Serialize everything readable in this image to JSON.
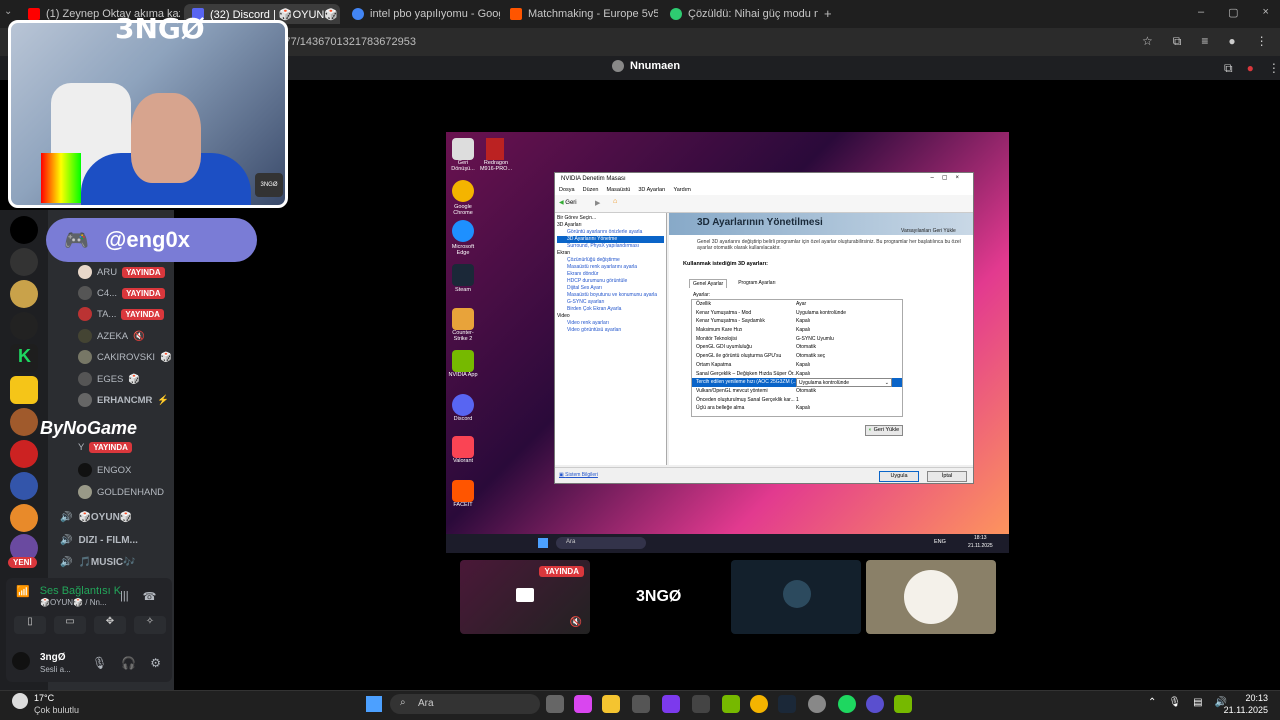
{
  "browser": {
    "tabs": [
      {
        "label": "(1) Zeynep Oktay akıma kaza",
        "icon": "youtube-icon",
        "color": "#ff0000"
      },
      {
        "label": "(32) Discord | 🎲OYUN🎲",
        "icon": "discord-icon",
        "color": "#5865f2"
      },
      {
        "label": "intel pbo yapılıyomu - Google'd",
        "icon": "google-icon",
        "color": "#4285f4"
      },
      {
        "label": "Matchmaking - Europe 5v5 Qu",
        "icon": "faceit-icon",
        "color": "#ff5500"
      },
      {
        "label": "Çözüldü: Nihai güç modu nasıl",
        "icon": "check-icon",
        "color": "#2ecc71"
      }
    ],
    "url": "489477/1436701321783672953"
  },
  "discord": {
    "stream_title": "Nnumaen",
    "name_tag": "@eng0x",
    "watermark": "ByNoGame",
    "members": [
      {
        "name": "ARU",
        "badge": "YAYINDA"
      },
      {
        "name": "C4...",
        "badge": "YAYINDA"
      },
      {
        "name": "TA...",
        "badge": "YAYINDA"
      },
      {
        "name": "AZEKA",
        "badge": ""
      },
      {
        "name": "CAKIROVSKI",
        "badge": ""
      },
      {
        "name": "EGES",
        "badge": ""
      },
      {
        "name": "ERHANCMR",
        "badge": ""
      },
      {
        "name": "Y",
        "badge": "YAYINDA"
      },
      {
        "name": "ENGOX",
        "badge": ""
      },
      {
        "name": "GOLDENHAND",
        "badge": ""
      }
    ],
    "voice_channels": [
      "🎲OYUN🎲",
      "DIZI - FILM...",
      "🎵MUSIC🎶"
    ],
    "new_label": "YENİ",
    "voice_status": "Ses Bağlantısı K",
    "voice_channel_sub": "🎲OYUN🎲 / Nn...",
    "user": {
      "name": "3ngØ",
      "status": "Sesli a..."
    },
    "thumb_badge": "YAYINDA",
    "thumb_logo": "3NGØ",
    "cam_logo": "3NGØ"
  },
  "desktop": {
    "icons": [
      "Geri Dönüşü...",
      "Google Chrome",
      "Microsoft Edge",
      "Steam",
      "Counter-Strike 2",
      "NVIDIA App",
      "Discord",
      "Valorant",
      "FACEIT"
    ],
    "file_icon": "Redragon M916-PRO...",
    "taskbar_search": "Ara",
    "lang": "ENG",
    "time": "18:13",
    "date": "21.11.2025"
  },
  "nvidia": {
    "title": "NVIDIA Denetim Masası",
    "menus": [
      "Dosya",
      "Düzen",
      "Masaüstü",
      "3D Ayarları",
      "Yardım"
    ],
    "back_label": "Geri",
    "task_label": "Bir Görev Seçin...",
    "tree": [
      "3D Ayarları",
      "Görüntü ayarlarını önizlerle ayarla",
      "3D Ayarlarını Yönetme",
      "Surround, PhysX yapılandırması",
      "Ekran",
      "Çözünürlüğü değiştirme",
      "Masaüstü renk ayarlarını ayarla",
      "Ekranı döndür",
      "HDCP durumunu görüntüle",
      "Dijital Ses Ayarı",
      "Masaüstü boyutunu ve konumunu ayarla",
      "G-SYNC ayarları",
      "Birden Çok Ekran Ayarla",
      "Video",
      "Video renk ayarları",
      "Video görüntüsü ayarları"
    ],
    "heading": "3D Ayarlarının Yönetilmesi",
    "restore": "Varsayılanları Geri Yükle",
    "desc": "Genel 3D ayarlarını değiştirip belirli programlar için özel ayarlar oluşturabilirsiniz. Bu programlar her başlatılınca bu özel ayarlar otomatik olarak kullanılacaktır.",
    "section": "Kullanmak istediğim 3D ayarları:",
    "tabs": [
      "Genel Ayarlar",
      "Program Ayarları"
    ],
    "settings_label": "Ayarlar:",
    "settings": [
      [
        "Özellik",
        "Ayar"
      ],
      [
        "Kenar Yumuşatma - Mod",
        "Uygulama kontrolünde"
      ],
      [
        "Kenar Yumuşatma - Saydamlık",
        "Kapalı"
      ],
      [
        "Maksimum Kare Hızı",
        "Kapalı"
      ],
      [
        "Monitör Teknolojisi",
        "G-SYNC Uyumlu"
      ],
      [
        "OpenGL GDI uyumluluğu",
        "Otomatik"
      ],
      [
        "OpenGL ile görüntü oluşturma GPU'su",
        "Otomatik seç"
      ],
      [
        "Ortam Kapatma",
        "Kapalı"
      ],
      [
        "Sanal Gerçeklik – Değişken Hızda Süper Ör...",
        "Kapalı"
      ],
      [
        "Tercih edilen yenileme hızı (AOC 25G3ZM (...",
        "Uygulama kontrolünde"
      ],
      [
        "Vulkan/OpenGL mevcut yöntemi",
        "Otomatik"
      ],
      [
        "Önceden oluşturulmuş Sanal Gerçeklik kar...",
        "1"
      ],
      [
        "Üçlü ara belleğe alma",
        "Kapalı"
      ]
    ],
    "restore_btn": "Geri Yükle",
    "status_link": "Sistem Bilgileri",
    "apply": "Uygula",
    "cancel": "İptal"
  },
  "weather": {
    "temp": "17°C",
    "desc": "Çok bulutlu"
  },
  "taskbar": {
    "search": "Ara",
    "time": "20:13",
    "date": "21.11.2025"
  }
}
